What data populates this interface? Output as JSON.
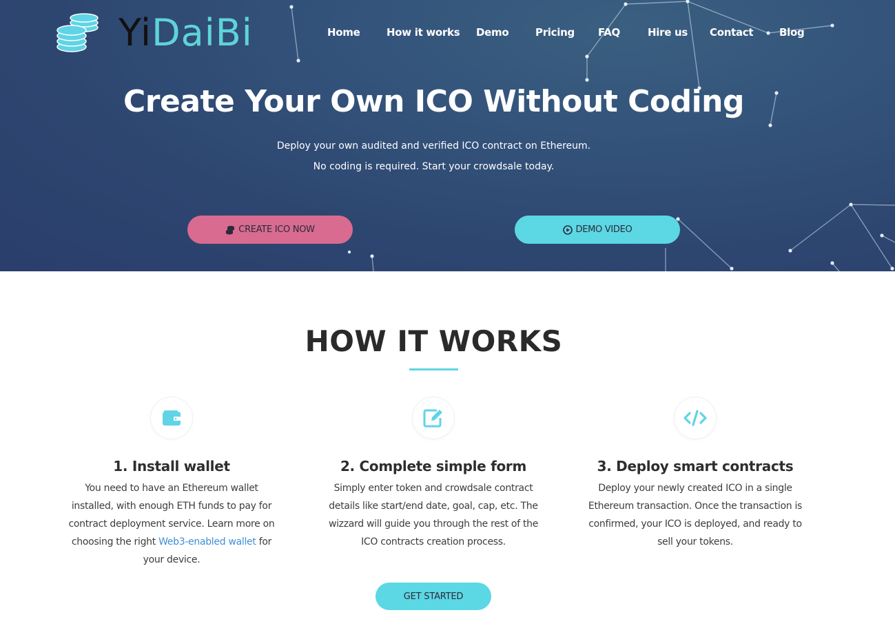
{
  "brand": {
    "name_part1": "Yi",
    "name_part2": "DaiBi",
    "logo_icon": "coins-stack-icon"
  },
  "nav": {
    "items": [
      {
        "label": "Home"
      },
      {
        "label": "How it works"
      },
      {
        "label": "Demo"
      },
      {
        "label": "Pricing"
      },
      {
        "label": "FAQ"
      },
      {
        "label": "Hire us"
      },
      {
        "label": "Contact"
      },
      {
        "label": "Blog"
      }
    ]
  },
  "hero": {
    "title": "Create Your Own ICO Without Coding",
    "subtitle_line1": "Deploy your own audited and verified ICO contract on Ethereum.",
    "subtitle_line2": "No coding is required. Start your crowdsale today.",
    "create_button": {
      "label": "CREATE ICO NOW",
      "icon": "database-icon",
      "color": "#d86b8f"
    },
    "demo_button": {
      "label": "DEMO VIDEO",
      "icon": "play-circle-icon",
      "color": "#5cd7e4"
    }
  },
  "how_it_works": {
    "title": "HOW IT WORKS",
    "accent_color": "#5fd4e0",
    "steps": [
      {
        "icon": "wallet-icon",
        "title": "1. Install wallet",
        "text_before": "You need to have an Ethereum wallet installed, with enough ETH funds to pay for contract deployment service. Learn more on choosing the right ",
        "link_text": "Web3-enabled wallet",
        "text_after": " for your device."
      },
      {
        "icon": "edit-form-icon",
        "title": "2. Complete simple form",
        "text": "Simply enter token and crowdsale contract details like start/end date, goal, cap, etc. The wizzard will guide you through the rest of the ICO contracts creation process."
      },
      {
        "icon": "code-icon",
        "title": "3. Deploy smart contracts",
        "text": "Deploy your newly created ICO in a single Ethereum transaction. Once the transaction is confirmed, your ICO is deployed, and ready to sell your tokens."
      }
    ],
    "cta_label": "GET STARTED"
  }
}
